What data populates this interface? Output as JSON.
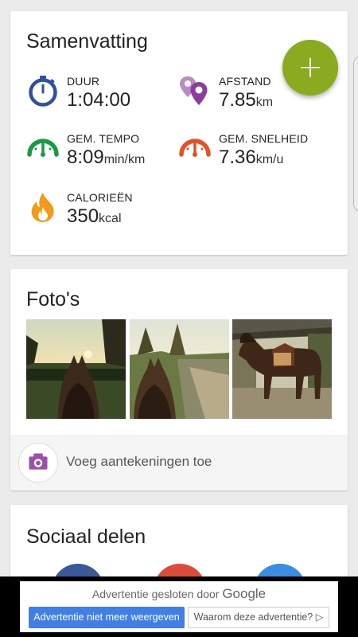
{
  "summary": {
    "title": "Samenvatting",
    "fab_label": "+",
    "stats": {
      "duration": {
        "label": "DUUR",
        "value": "1:04:00",
        "unit": ""
      },
      "distance": {
        "label": "AFSTAND",
        "value": "7.85",
        "unit": "km"
      },
      "pace": {
        "label": "GEM. TEMPO",
        "value": "8:09",
        "unit": "min/km"
      },
      "speed": {
        "label": "GEM. SNELHEID",
        "value": "7.36",
        "unit": "km/u"
      },
      "calories": {
        "label": "CALORIEËN",
        "value": "350",
        "unit": "kcal"
      }
    }
  },
  "photos": {
    "title": "Foto's",
    "items": [
      "photo-sunset-field",
      "photo-sandy-path",
      "photo-horse-saddled"
    ],
    "notes_label": "Voeg aantekeningen toe"
  },
  "social": {
    "title": "Sociaal delen"
  },
  "ad": {
    "closed_text": "Advertentie gesloten door",
    "brand": "Google",
    "hide_button": "Advertentie niet meer weergeven",
    "why_button": "Waarom deze advertentie? ▷"
  },
  "colors": {
    "fab": "#8aaa1f",
    "duration_icon": "#2e4fa2",
    "distance_icon": "#8e3c9c",
    "pace_icon": "#1b9a45",
    "speed_icon": "#e3502a",
    "calories_icon": "#f39a1a",
    "camera_icon": "#9c4fae",
    "share_facebook": "#3b5998",
    "share_google": "#dd4b39",
    "share_twitter": "#3a8de3"
  }
}
